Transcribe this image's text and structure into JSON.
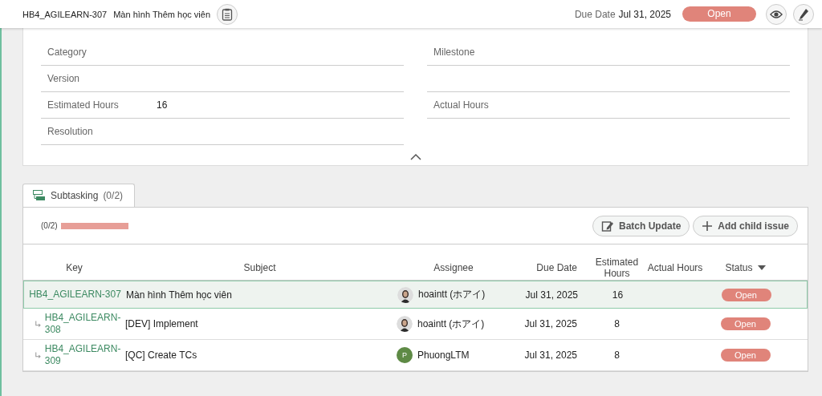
{
  "header": {
    "key": "HB4_AGILEARN-307",
    "title": "Màn hình Thêm học viên",
    "due_label": "Due Date",
    "due_value": "Jul 31, 2025",
    "status": "Open"
  },
  "details": {
    "rows": [
      {
        "left": {
          "label": "Category"
        },
        "right": {
          "label": "Milestone"
        }
      },
      {
        "left": {
          "label": "Version"
        },
        "right_line": true
      },
      {
        "left": {
          "label": "Estimated Hours",
          "value": "16"
        },
        "right": {
          "label": "Actual Hours"
        }
      },
      {
        "left": {
          "label": "Resolution"
        }
      }
    ]
  },
  "tabs": [
    {
      "label": "Subtasking",
      "count": "(0/2)",
      "selected": true
    }
  ],
  "progress": {
    "text": "(0/2)",
    "level": 0
  },
  "buttons": [
    {
      "kind": "batch",
      "label": "Batch Update"
    },
    {
      "kind": "add",
      "label": "Add child issue"
    }
  ],
  "table": {
    "columns": [
      {
        "label": "Key"
      },
      {
        "label": "Subject"
      },
      {
        "label": "Assignee"
      },
      {
        "label": "Due Date"
      },
      {
        "label": "Estimated Hours"
      },
      {
        "label": "Actual Hours"
      },
      {
        "label": "Status",
        "sorted": true
      }
    ],
    "rows": [
      {
        "key": "HB4_AGILEARN-307",
        "subject": "Màn hình Thêm học viên",
        "assignee": {
          "name": "hoaintt (ホアイ)",
          "kind": "photo"
        },
        "due": "Jul 31, 2025",
        "estimated": "16",
        "status": "Open",
        "selected": true,
        "children": [
          {
            "key": "HB4_AGILEARN-308",
            "subject": "[DEV] Implement",
            "assignee": {
              "name": "hoaintt (ホアイ)",
              "kind": "photo"
            },
            "due": "Jul 31, 2025",
            "estimated": "8",
            "status": "Open",
            "selected": false
          },
          {
            "key": "HB4_AGILEARN-309",
            "subject": "[QC] Create TCs",
            "assignee": {
              "name": "PhuongLTM",
              "kind": "initial",
              "initial": "P",
              "color": "#5e8a45"
            },
            "due": "Jul 31, 2025",
            "estimated": "8",
            "status": "Open",
            "selected": false
          }
        ]
      }
    ]
  }
}
